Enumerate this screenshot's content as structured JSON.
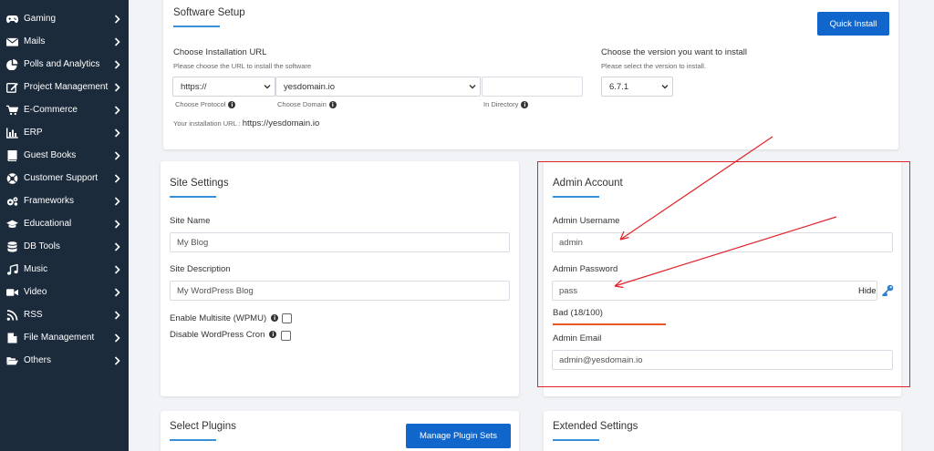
{
  "sidebar": {
    "items": [
      {
        "label": "Gaming",
        "icon": "gamepad-icon"
      },
      {
        "label": "Mails",
        "icon": "envelope-icon"
      },
      {
        "label": "Polls and Analytics",
        "icon": "pie-chart-icon"
      },
      {
        "label": "Project Management",
        "icon": "edit-icon"
      },
      {
        "label": "E-Commerce",
        "icon": "shopping-cart-icon"
      },
      {
        "label": "ERP",
        "icon": "bar-chart-icon"
      },
      {
        "label": "Guest Books",
        "icon": "book-icon"
      },
      {
        "label": "Customer Support",
        "icon": "lifebuoy-icon"
      },
      {
        "label": "Frameworks",
        "icon": "cogs-icon"
      },
      {
        "label": "Educational",
        "icon": "graduation-cap-icon"
      },
      {
        "label": "DB Tools",
        "icon": "database-icon"
      },
      {
        "label": "Music",
        "icon": "music-icon"
      },
      {
        "label": "Video",
        "icon": "video-icon"
      },
      {
        "label": "RSS",
        "icon": "rss-icon"
      },
      {
        "label": "File Management",
        "icon": "file-icon"
      },
      {
        "label": "Others",
        "icon": "folder-open-icon"
      }
    ]
  },
  "software_setup": {
    "title": "Software Setup",
    "quick_install_label": "Quick Install",
    "install_url_label": "Choose Installation URL",
    "install_url_hint": "Please choose the URL to install the software",
    "protocol_value": "https://",
    "domain_value": "yesdomain.io",
    "directory_value": "",
    "choose_protocol_label": "Choose Protocol",
    "choose_domain_label": "Choose Domain",
    "in_directory_label": "In Directory",
    "your_url_label": "Your installation URL :",
    "your_url_value": "https://yesdomain.io",
    "version_label": "Choose the version you want to install",
    "version_hint": "Please select the version to install.",
    "version_value": "6.7.1"
  },
  "site_settings": {
    "title": "Site Settings",
    "site_name_label": "Site Name",
    "site_name_value": "My Blog",
    "site_description_label": "Site Description",
    "site_description_value": "My WordPress Blog",
    "multisite_label": "Enable Multisite (WPMU)",
    "disable_cron_label": "Disable WordPress Cron"
  },
  "admin_account": {
    "title": "Admin Account",
    "username_label": "Admin Username",
    "username_value": "admin",
    "password_label": "Admin Password",
    "password_value": "pass",
    "hide_label": "Hide",
    "strength_label": "Bad (18/100)",
    "email_label": "Admin Email",
    "email_value": "admin@yesdomain.io"
  },
  "select_plugins": {
    "title": "Select Plugins",
    "manage_label": "Manage Plugin Sets"
  },
  "extended_settings": {
    "title": "Extended Settings"
  },
  "colors": {
    "sidebar_bg": "#1c2b3c",
    "accent": "#1166cc",
    "underline": "#3a8fd9",
    "strength_bad": "#e8562a",
    "annotation_red": "#e0242b"
  }
}
